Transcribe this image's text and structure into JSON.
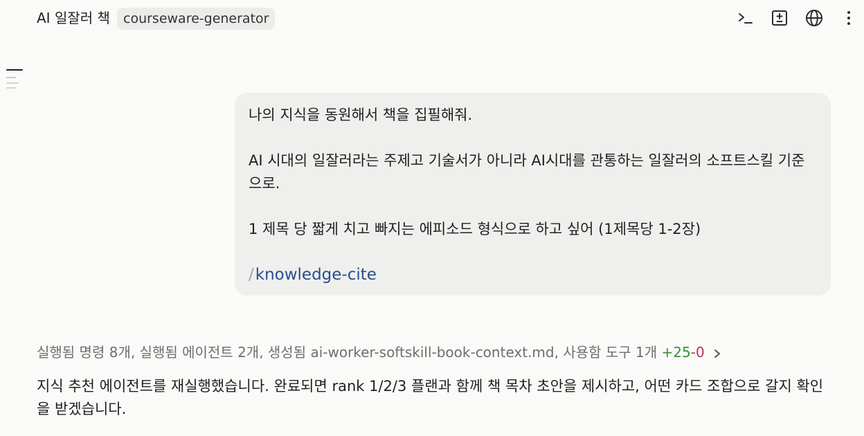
{
  "header": {
    "title": "AI 일잘러 책",
    "tag": "courseware-generator",
    "icons": [
      "terminal-icon",
      "diff-icon",
      "globe-icon",
      "more-vertical-icon"
    ]
  },
  "user_message": {
    "line1": "나의 지식을 동원해서 책을 집필해줘.",
    "line2": "AI 시대의 일잘러라는 주제고 기술서가 아니라 AI시대를 관통하는 일잘러의 소프트스킬 기준으로.",
    "line3": "1 제목 당 짧게 치고 빠지는 에피소드 형식으로 하고 싶어 (1제목당 1-2장)",
    "command_slash": "/",
    "command": "knowledge-cite"
  },
  "activity": {
    "summary": "실행됨 명령 8개, 실행됨 에이전트 2개, 생성됨 ai-worker-softskill-book-context.md, 사용함 도구 1개",
    "added": "+25",
    "removed": "-0"
  },
  "assistant_reply": "지식 추천 에이전트를 재실행했습니다. 완료되면 rank 1/2/3 플랜과 함께 책 목차 초안을 제시하고, 어떤 카드 조합으로 갈지 확인을 받겠습니다.",
  "colors": {
    "background": "#fafaf8",
    "bubble": "#efefed",
    "command": "#2a4f8c",
    "added": "#3e8e3e",
    "removed": "#b03a5a"
  }
}
